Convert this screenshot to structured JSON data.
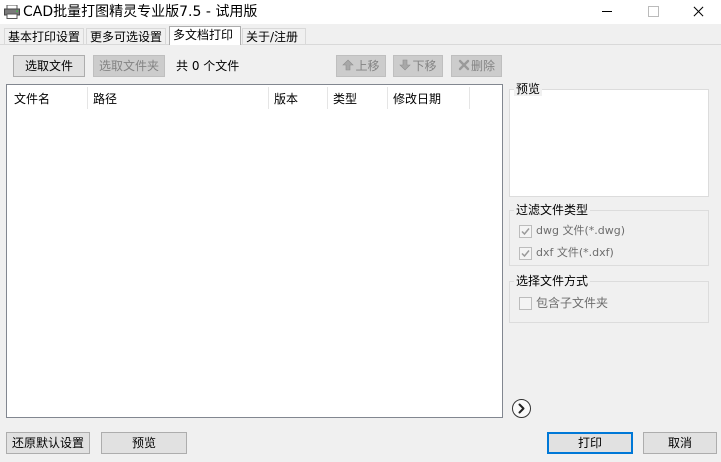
{
  "window": {
    "title": "CAD批量打图精灵专业版7.5 - 试用版"
  },
  "tabs": [
    {
      "label": "基本打印设置",
      "active": false
    },
    {
      "label": "更多可选设置",
      "active": false
    },
    {
      "label": "多文档打印",
      "active": true
    },
    {
      "label": "关于/注册",
      "active": false
    }
  ],
  "toolbar": {
    "select_files_label": "选取文件",
    "select_folder_label": "选取文件夹",
    "file_count_text": "共 0 个文件",
    "move_up_label": "上移",
    "move_down_label": "下移",
    "delete_label": "删除"
  },
  "file_list": {
    "columns": [
      "文件名",
      "路径",
      "版本",
      "类型",
      "修改日期"
    ],
    "rows": []
  },
  "preview": {
    "label": "预览"
  },
  "filter": {
    "label": "过滤文件类型",
    "options": [
      {
        "label": "dwg 文件(*.dwg)",
        "checked": true,
        "enabled": false
      },
      {
        "label": "dxf 文件(*.dxf)",
        "checked": true,
        "enabled": false
      }
    ]
  },
  "selection_mode": {
    "label": "选择文件方式",
    "include_subfolders_label": "包含子文件夹",
    "include_subfolders_checked": false
  },
  "footer": {
    "restore_defaults_label": "还原默认设置",
    "preview_label": "预览",
    "print_label": "打印",
    "cancel_label": "取消"
  },
  "colors": {
    "accent": "#0078d7",
    "window_bg": "#f0f0f0",
    "list_bg": "#ffffff"
  },
  "icons": {
    "app": "printer-icon",
    "move_up": "arrow-up-icon",
    "move_down": "arrow-down-icon",
    "delete": "x-icon",
    "expand": "chevron-right-icon"
  }
}
